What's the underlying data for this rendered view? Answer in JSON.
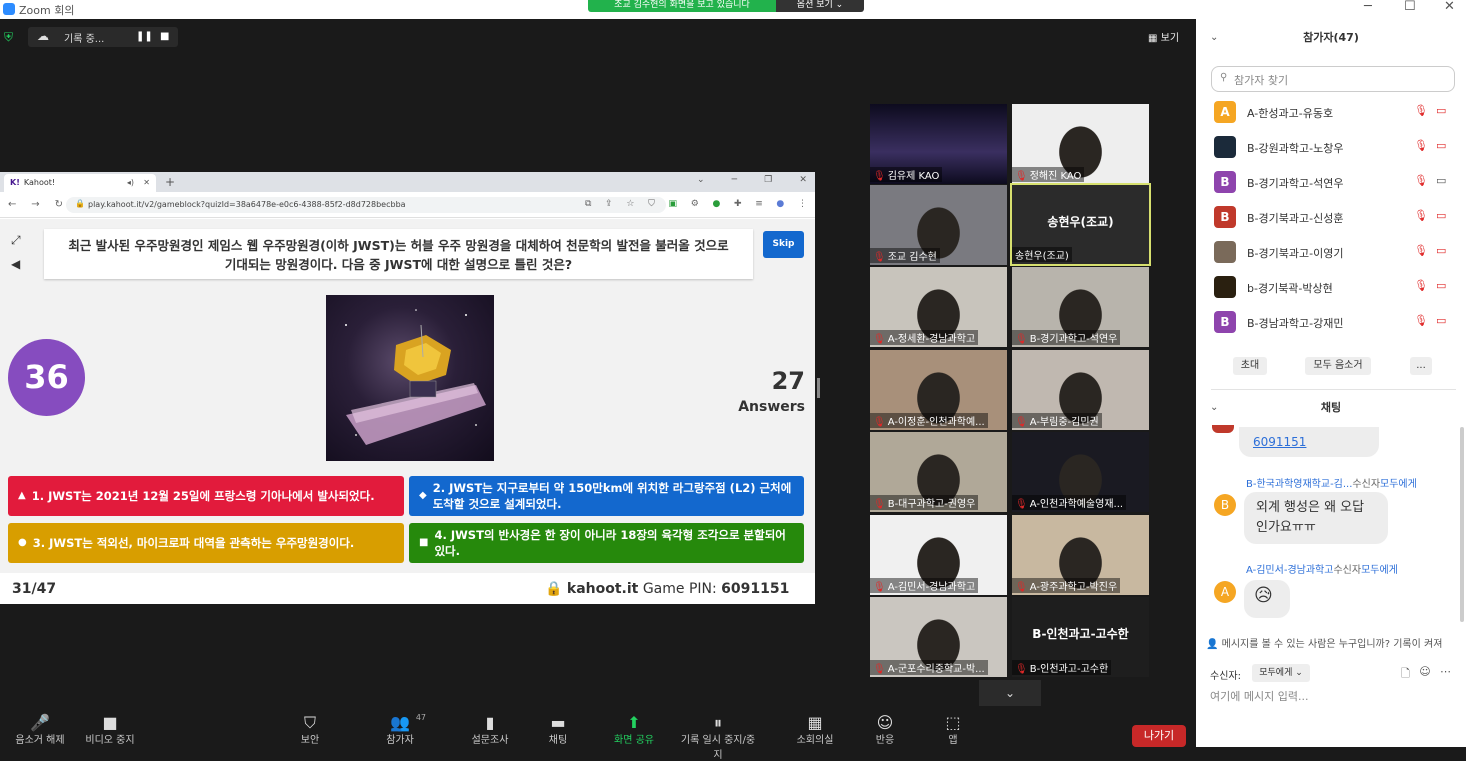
{
  "window": {
    "title": "Zoom 회의",
    "share_banner": "조교 김수현의 화면을 보고 있습니다",
    "view_options": "옵션 보기 ⌄",
    "controls": [
      "─",
      "☐",
      "✕"
    ]
  },
  "recording": {
    "label": "기록 중...",
    "view_button": "보기"
  },
  "browser": {
    "tab_title": "Kahoot!",
    "url": "play.kahoot.it/v2/gameblock?quizId=38a6478e-e0c6-4388-85f2-d8d728becbba"
  },
  "kahoot": {
    "question": "최근 발사된 우주망원경인 제임스 웹 우주망원경(이하 JWST)는 허블 우주 망원경을 대체하여 천문학의 발전을 불러올 것으로 기대되는 망원경이다. 다음 중 JWST에 대한 설명으로 틀린 것은?",
    "skip": "Skip",
    "timer": "36",
    "answers_count": "27",
    "answers_label": "Answers",
    "answers": [
      {
        "symbol": "▲",
        "text": "1. JWST는 2021년 12월 25일에 프랑스령 기아나에서 발사되었다.",
        "color": "#e21b3c"
      },
      {
        "symbol": "◆",
        "text": "2. JWST는 지구로부터 약 150만km에 위치한 라그랑주점 (L2) 근처에 도착할 것으로 설계되었다.",
        "color": "#1368ce"
      },
      {
        "symbol": "●",
        "text": "3. JWST는 적외선, 마이크로파 대역을 관측하는 우주망원경이다.",
        "color": "#d89e00"
      },
      {
        "symbol": "■",
        "text": "4. JWST의 반사경은 한 장이 아니라 18장의 육각형 조각으로 분할되어 있다.",
        "color": "#26890c"
      }
    ],
    "progress": "31/47",
    "site": "kahoot.it",
    "pin_label": "Game PIN:",
    "pin": "6091151"
  },
  "tiles": [
    {
      "name": "김유제 KAO"
    },
    {
      "name": "정해진 KAO"
    },
    {
      "name": "조교 김수현"
    },
    {
      "name": "송현우(조교)",
      "center": "송현우(조교)"
    },
    {
      "name": "A-정세환-경남과학고"
    },
    {
      "name": "B-경기과학고-석연우"
    },
    {
      "name": "A-이정훈-인천과학예..."
    },
    {
      "name": "A-부림중-김민권"
    },
    {
      "name": "B-대구과학고-권영우"
    },
    {
      "name": "A-인천과학예술영재..."
    },
    {
      "name": "A-김민서-경남과학고"
    },
    {
      "name": "A-광주과학고-박진우"
    },
    {
      "name": "A-군포수리중학교-박..."
    },
    {
      "name": "B-인천과고-고수한",
      "center": "B-인천과고-고수한"
    }
  ],
  "toolbar": [
    {
      "label": "음소거 해제",
      "glyph": "🎤"
    },
    {
      "label": "비디오 중지",
      "glyph": "■"
    },
    {
      "label": "보안",
      "glyph": "⛉"
    },
    {
      "label": "참가자",
      "glyph": "👥",
      "count": "47"
    },
    {
      "label": "설문조사",
      "glyph": "▮"
    },
    {
      "label": "채팅",
      "glyph": "▬"
    },
    {
      "label": "화면 공유",
      "glyph": "⬆"
    },
    {
      "label": "기록 일시 중지/중지",
      "glyph": "⏸"
    },
    {
      "label": "소회의실",
      "glyph": "▦"
    },
    {
      "label": "반응",
      "glyph": "☺"
    },
    {
      "label": "앱",
      "glyph": "⬚"
    }
  ],
  "leave": "나가기",
  "participants": {
    "title": "참가자(47)",
    "search_placeholder": "참가자 찾기",
    "list": [
      {
        "initial": "A",
        "name": "A-한성과고-유동호",
        "color": "#f5a623"
      },
      {
        "initial": "",
        "name": "B-강원과학고-노창우",
        "color": "#1b2a3a"
      },
      {
        "initial": "B",
        "name": "B-경기과학고-석연우",
        "color": "#8e44ad"
      },
      {
        "initial": "B",
        "name": "B-경기북과고-신성훈",
        "color": "#c0392b"
      },
      {
        "initial": "",
        "name": "B-경기북과고-이영기",
        "color": "#7a6a5a"
      },
      {
        "initial": "",
        "name": "b-경기북곽-박상현",
        "color": "#2a2010"
      },
      {
        "initial": "B",
        "name": "B-경남과학고-강재민",
        "color": "#8e44ad"
      }
    ],
    "invite": "초대",
    "mute_all": "모두 음소거",
    "more": "..."
  },
  "chat": {
    "title": "채팅",
    "link_text": "6091151",
    "messages": [
      {
        "sender": "B-한국과학영재학교-김...",
        "to_label": "수신자",
        "to": "모두에게",
        "initial": "B",
        "text": "외계 행성은 왜 오답인가요ㅠㅠ"
      },
      {
        "sender": "A-김민서-경남과학고",
        "to_label": "수신자",
        "to": "모두에게",
        "initial": "A",
        "text": "😥"
      }
    ],
    "info": "메시지를 볼 수 있는 사람은 누구입니까? 기록이 켜져",
    "recipient_label": "수신자:",
    "recipient": "모두에게 ⌄",
    "input_placeholder": "여기에 메시지 입력..."
  }
}
